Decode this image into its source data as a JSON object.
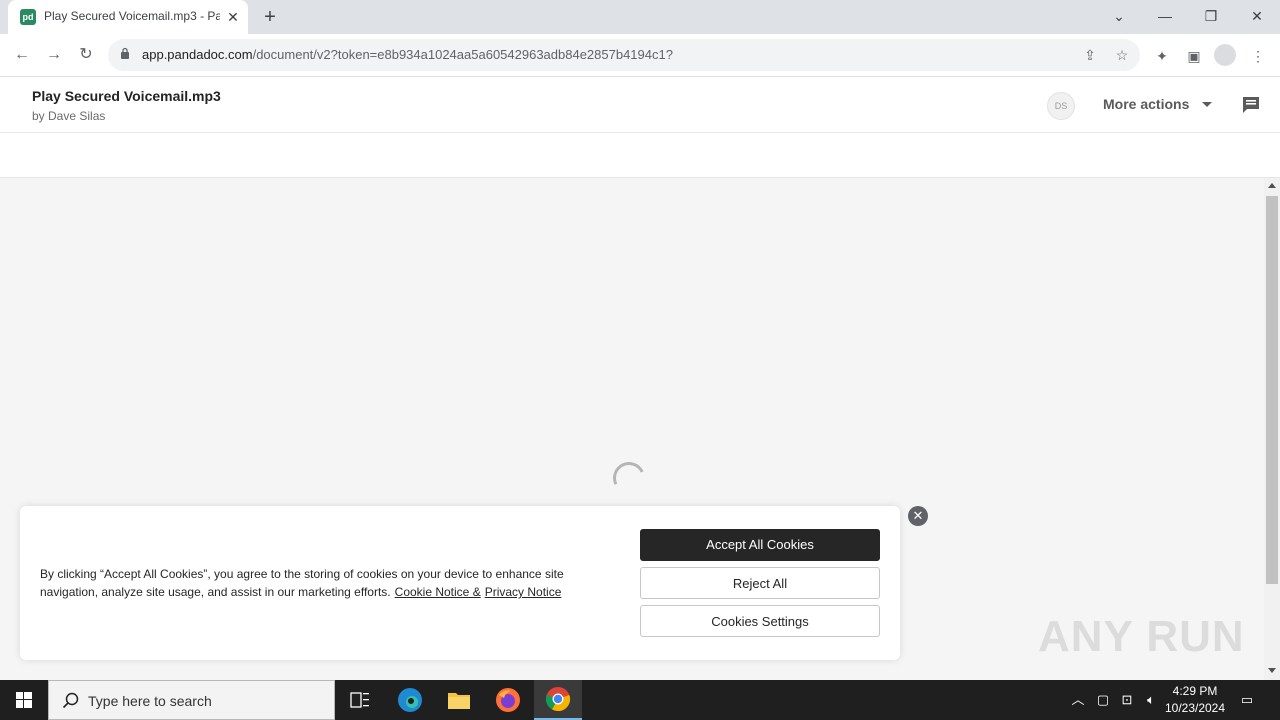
{
  "browser": {
    "tab_title": "Play Secured Voicemail.mp3 - Pa",
    "favicon_text": "pd",
    "url_host": "app.pandadoc.com",
    "url_path": "/document/v2?token=e8b934a1024aa5a60542963adb84e2857b4194c1?"
  },
  "app": {
    "doc_title": "Play Secured Voicemail.mp3",
    "doc_author": "by Dave Silas",
    "avatar_initials": "DS",
    "more_actions": "More actions"
  },
  "cookie": {
    "text": "By clicking “Accept All Cookies”, you agree to the storing of cookies on your device to enhance site navigation, analyze site usage, and assist in our marketing efforts.",
    "link1": "Cookie Notice &",
    "link2": "Privacy Notice",
    "accept": "Accept All Cookies",
    "reject": "Reject All",
    "settings": "Cookies Settings"
  },
  "watermark": "ANY RUN",
  "taskbar": {
    "search_placeholder": "Type here to search",
    "time": "4:29 PM",
    "date": "10/23/2024"
  },
  "colors": {
    "accent_dark": "#262626",
    "pandadoc_green": "#2a8b63"
  }
}
